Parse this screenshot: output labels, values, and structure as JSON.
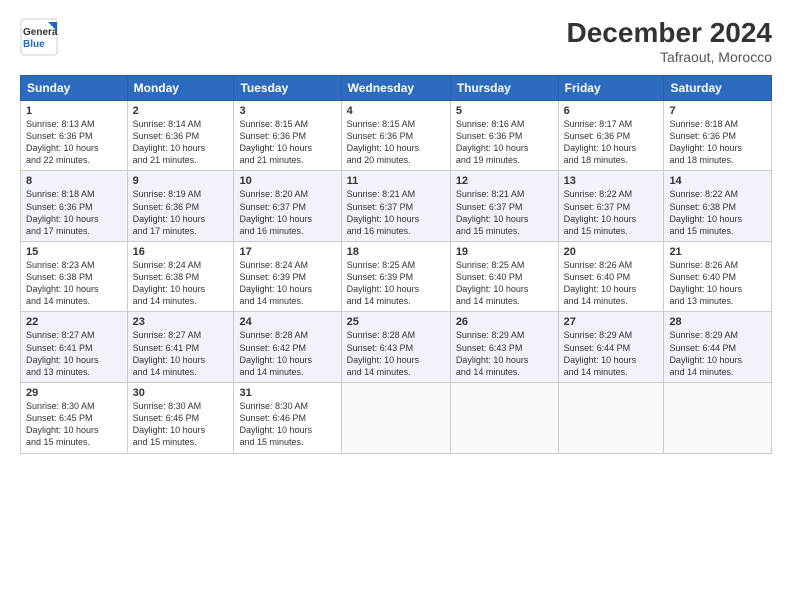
{
  "logo": {
    "line1": "General",
    "line2": "Blue"
  },
  "title": "December 2024",
  "subtitle": "Tafraout, Morocco",
  "days_header": [
    "Sunday",
    "Monday",
    "Tuesday",
    "Wednesday",
    "Thursday",
    "Friday",
    "Saturday"
  ],
  "weeks": [
    [
      {
        "day": "1",
        "text": "Sunrise: 8:13 AM\nSunset: 6:36 PM\nDaylight: 10 hours\nand 22 minutes."
      },
      {
        "day": "2",
        "text": "Sunrise: 8:14 AM\nSunset: 6:36 PM\nDaylight: 10 hours\nand 21 minutes."
      },
      {
        "day": "3",
        "text": "Sunrise: 8:15 AM\nSunset: 6:36 PM\nDaylight: 10 hours\nand 21 minutes."
      },
      {
        "day": "4",
        "text": "Sunrise: 8:15 AM\nSunset: 6:36 PM\nDaylight: 10 hours\nand 20 minutes."
      },
      {
        "day": "5",
        "text": "Sunrise: 8:16 AM\nSunset: 6:36 PM\nDaylight: 10 hours\nand 19 minutes."
      },
      {
        "day": "6",
        "text": "Sunrise: 8:17 AM\nSunset: 6:36 PM\nDaylight: 10 hours\nand 18 minutes."
      },
      {
        "day": "7",
        "text": "Sunrise: 8:18 AM\nSunset: 6:36 PM\nDaylight: 10 hours\nand 18 minutes."
      }
    ],
    [
      {
        "day": "8",
        "text": "Sunrise: 8:18 AM\nSunset: 6:36 PM\nDaylight: 10 hours\nand 17 minutes."
      },
      {
        "day": "9",
        "text": "Sunrise: 8:19 AM\nSunset: 6:36 PM\nDaylight: 10 hours\nand 17 minutes."
      },
      {
        "day": "10",
        "text": "Sunrise: 8:20 AM\nSunset: 6:37 PM\nDaylight: 10 hours\nand 16 minutes."
      },
      {
        "day": "11",
        "text": "Sunrise: 8:21 AM\nSunset: 6:37 PM\nDaylight: 10 hours\nand 16 minutes."
      },
      {
        "day": "12",
        "text": "Sunrise: 8:21 AM\nSunset: 6:37 PM\nDaylight: 10 hours\nand 15 minutes."
      },
      {
        "day": "13",
        "text": "Sunrise: 8:22 AM\nSunset: 6:37 PM\nDaylight: 10 hours\nand 15 minutes."
      },
      {
        "day": "14",
        "text": "Sunrise: 8:22 AM\nSunset: 6:38 PM\nDaylight: 10 hours\nand 15 minutes."
      }
    ],
    [
      {
        "day": "15",
        "text": "Sunrise: 8:23 AM\nSunset: 6:38 PM\nDaylight: 10 hours\nand 14 minutes."
      },
      {
        "day": "16",
        "text": "Sunrise: 8:24 AM\nSunset: 6:38 PM\nDaylight: 10 hours\nand 14 minutes."
      },
      {
        "day": "17",
        "text": "Sunrise: 8:24 AM\nSunset: 6:39 PM\nDaylight: 10 hours\nand 14 minutes."
      },
      {
        "day": "18",
        "text": "Sunrise: 8:25 AM\nSunset: 6:39 PM\nDaylight: 10 hours\nand 14 minutes."
      },
      {
        "day": "19",
        "text": "Sunrise: 8:25 AM\nSunset: 6:40 PM\nDaylight: 10 hours\nand 14 minutes."
      },
      {
        "day": "20",
        "text": "Sunrise: 8:26 AM\nSunset: 6:40 PM\nDaylight: 10 hours\nand 14 minutes."
      },
      {
        "day": "21",
        "text": "Sunrise: 8:26 AM\nSunset: 6:40 PM\nDaylight: 10 hours\nand 13 minutes."
      }
    ],
    [
      {
        "day": "22",
        "text": "Sunrise: 8:27 AM\nSunset: 6:41 PM\nDaylight: 10 hours\nand 13 minutes."
      },
      {
        "day": "23",
        "text": "Sunrise: 8:27 AM\nSunset: 6:41 PM\nDaylight: 10 hours\nand 14 minutes."
      },
      {
        "day": "24",
        "text": "Sunrise: 8:28 AM\nSunset: 6:42 PM\nDaylight: 10 hours\nand 14 minutes."
      },
      {
        "day": "25",
        "text": "Sunrise: 8:28 AM\nSunset: 6:43 PM\nDaylight: 10 hours\nand 14 minutes."
      },
      {
        "day": "26",
        "text": "Sunrise: 8:29 AM\nSunset: 6:43 PM\nDaylight: 10 hours\nand 14 minutes."
      },
      {
        "day": "27",
        "text": "Sunrise: 8:29 AM\nSunset: 6:44 PM\nDaylight: 10 hours\nand 14 minutes."
      },
      {
        "day": "28",
        "text": "Sunrise: 8:29 AM\nSunset: 6:44 PM\nDaylight: 10 hours\nand 14 minutes."
      }
    ],
    [
      {
        "day": "29",
        "text": "Sunrise: 8:30 AM\nSunset: 6:45 PM\nDaylight: 10 hours\nand 15 minutes."
      },
      {
        "day": "30",
        "text": "Sunrise: 8:30 AM\nSunset: 6:46 PM\nDaylight: 10 hours\nand 15 minutes."
      },
      {
        "day": "31",
        "text": "Sunrise: 8:30 AM\nSunset: 6:46 PM\nDaylight: 10 hours\nand 15 minutes."
      },
      {
        "day": "",
        "text": ""
      },
      {
        "day": "",
        "text": ""
      },
      {
        "day": "",
        "text": ""
      },
      {
        "day": "",
        "text": ""
      }
    ]
  ]
}
